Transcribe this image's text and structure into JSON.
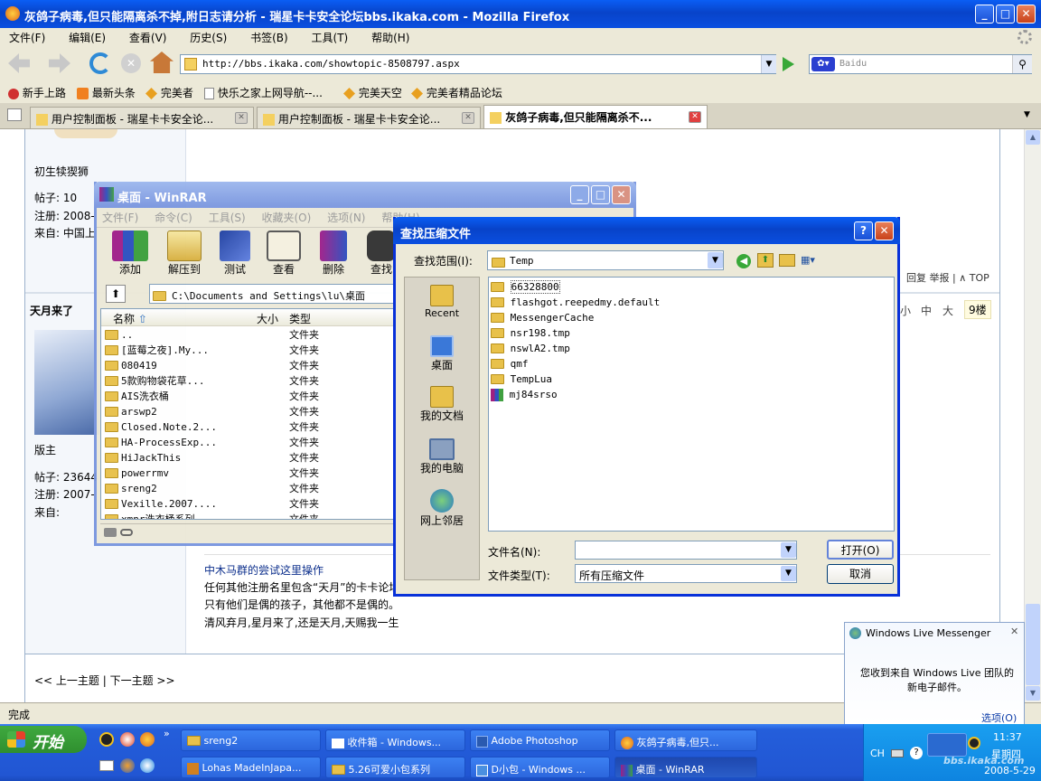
{
  "firefox": {
    "title": "灰鸽子病毒,但只能隔离杀不掉,附日志请分析 - 瑞星卡卡安全论坛bbs.ikaka.com - Mozilla Firefox",
    "menu": [
      "文件(F)",
      "编辑(E)",
      "查看(V)",
      "历史(S)",
      "书签(B)",
      "工具(T)",
      "帮助(H)"
    ],
    "url": "http://bbs.ikaka.com/showtopic-8508797.aspx",
    "search_placeholder": "Baidu",
    "bookmarks": [
      "新手上路",
      "最新头条",
      "完美者",
      "快乐之家上网导航--...",
      "完美天空",
      "完美者精品论坛"
    ],
    "tabs": [
      "用户控制面板 - 瑞星卡卡安全论...",
      "用户控制面板 - 瑞星卡卡安全论...",
      "灰鸽子病毒,但只能隔离杀不..."
    ],
    "status": "完成"
  },
  "forum": {
    "user1_rank": "初生犊猰狮",
    "user1_posts": "帖子: 10",
    "user1_reg": "注册: 2008-",
    "user1_from": "来自: 中国上",
    "post_actions": "回复 举报 | ∧ TOP",
    "user2_name": "天月来了",
    "font_sizes": [
      "小",
      "中",
      "大"
    ],
    "floor": "9楼",
    "user2_rank": "版主",
    "user2_posts": "帖子: 23644",
    "user2_reg": "注册: 2007-",
    "user2_from": "来自:",
    "sig_link": "中木马群的尝试这里操作",
    "sig_lines": [
      "任何其他注册名里包含“天月”的卡卡论坛",
      "只有他们是偶的孩子，其他都不是偶的。",
      "清风弃月,星月来了,还是天月,天赐我一生"
    ],
    "nav": "<< 上一主题 | 下一主题 >>"
  },
  "winrar": {
    "title": "桌面 - WinRAR",
    "menu": [
      "文件(F)",
      "命令(C)",
      "工具(S)",
      "收藏夹(O)",
      "选项(N)",
      "帮助(H)"
    ],
    "tools": [
      "添加",
      "解压到",
      "测试",
      "查看",
      "删除",
      "查找"
    ],
    "path": "C:\\Documents and Settings\\lu\\桌面",
    "col_name": "名称",
    "col_size": "大小",
    "col_type": "类型",
    "files": [
      {
        "name": "..",
        "type": "文件夹"
      },
      {
        "name": "[蓝莓之夜].My...",
        "type": "文件夹"
      },
      {
        "name": "080419",
        "type": "文件夹"
      },
      {
        "name": "5款购物袋花草...",
        "type": "文件夹"
      },
      {
        "name": "AIS洗衣桶",
        "type": "文件夹"
      },
      {
        "name": "arswp2",
        "type": "文件夹"
      },
      {
        "name": "Closed.Note.2...",
        "type": "文件夹"
      },
      {
        "name": "HA-ProcessExp...",
        "type": "文件夹"
      },
      {
        "name": "HiJackThis",
        "type": "文件夹"
      },
      {
        "name": "powerrmv",
        "type": "文件夹"
      },
      {
        "name": "sreng2",
        "type": "文件夹"
      },
      {
        "name": "Vexille.2007....",
        "type": "文件夹"
      },
      {
        "name": "xmnr洗衣桶系列",
        "type": "文件夹"
      }
    ]
  },
  "dialog": {
    "title": "查找压缩文件",
    "lookin_label": "查找范围(I):",
    "lookin_value": "Temp",
    "places": [
      "Recent",
      "桌面",
      "我的文档",
      "我的电脑",
      "网上邻居"
    ],
    "items": [
      "66328800",
      "flashgot.reepedmy.default",
      "MessengerCache",
      "nsr198.tmp",
      "nswlA2.tmp",
      "qmf",
      "TempLua",
      "mj84srso"
    ],
    "filename_label": "文件名(N):",
    "filename_value": "",
    "filetype_label": "文件类型(T):",
    "filetype_value": "所有压缩文件",
    "open_btn": "打开(O)",
    "cancel_btn": "取消"
  },
  "messenger": {
    "title": "Windows Live Messenger",
    "message": "您收到来自 Windows Live 团队的新电子邮件。",
    "options": "选项(O)"
  },
  "taskbar": {
    "start": "开始",
    "row1": [
      "sreng2",
      "收件箱 - Windows...",
      "Adobe Photoshop",
      "灰鸽子病毒,但只..."
    ],
    "row2": [
      "Lohas MadeInJapa...",
      "5.26可爱小包系列",
      "D小包 - Windows ...",
      "桌面 - WinRAR"
    ],
    "lang": "CH",
    "time": "11:37",
    "weekday": "星期四",
    "date": "2008-5-29",
    "watermark": "bbs.ikaka.com"
  }
}
